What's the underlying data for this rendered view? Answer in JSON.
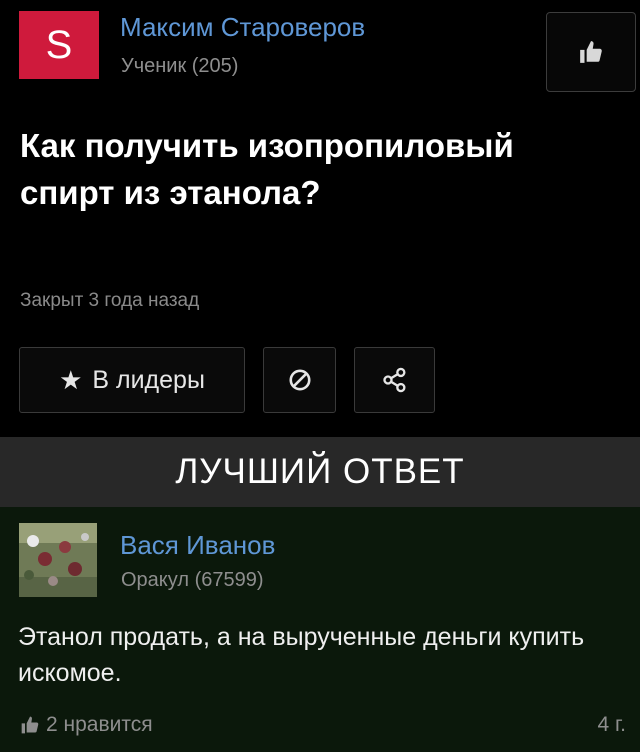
{
  "question": {
    "author": {
      "avatar_letter": "S",
      "avatar_color": "#cf1a3c",
      "name": "Максим Староверов",
      "rank": "Ученик (205)"
    },
    "like_icon": "thumbs-up-icon",
    "title": "Как получить изопропиловый спирт из этанола?",
    "status": "Закрыт 3 года назад",
    "buttons": {
      "leaders_label": "В лидеры",
      "leaders_icon": "star-icon",
      "block_icon": "block-icon",
      "share_icon": "share-icon"
    }
  },
  "best_answer": {
    "header": "ЛУЧШИЙ ОТВЕТ",
    "author": {
      "name": "Вася Иванов",
      "rank": "Оракул (67599)"
    },
    "text": "Этанол продать, а на вырученные деньги купить искомое.",
    "likes": "2 нравится",
    "time": "4 г."
  },
  "colors": {
    "link": "#5f97d6",
    "muted": "#8e8e8e",
    "answer_bg": "#0b180b",
    "header_bg": "#282828"
  }
}
